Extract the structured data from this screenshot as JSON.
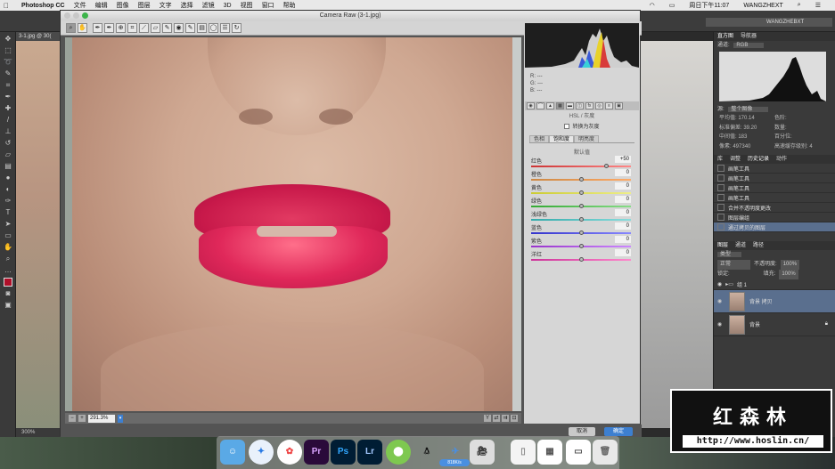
{
  "menubar": {
    "app": "Photoshop CC",
    "items": [
      "文件",
      "编辑",
      "图像",
      "图层",
      "文字",
      "选择",
      "滤镜",
      "3D",
      "视图",
      "窗口",
      "帮助"
    ],
    "clock": "周日下午11:07",
    "user": "WANGZHEXT"
  },
  "ps": {
    "doc_tab": "3-1.jpg @ 30(",
    "zoom_status": "300%",
    "workspace": "WANGZHEBXT"
  },
  "camera_raw": {
    "title": "Camera Raw (3-1.jpg)",
    "zoom": "291.3%",
    "rgb": {
      "r": "R:",
      "g": "G:",
      "b": "B:",
      "r_val": "---",
      "g_val": "---",
      "b_val": "---"
    },
    "panel_title": "HSL / 灰度",
    "convert_gray": "转换为灰度",
    "subtabs": [
      "色相",
      "饱和度",
      "明亮度"
    ],
    "default_link": "默认值",
    "sliders": [
      {
        "label": "红色",
        "value": "+50",
        "pos": 0.75
      },
      {
        "label": "橙色",
        "value": "0",
        "pos": 0.5
      },
      {
        "label": "黄色",
        "value": "0",
        "pos": 0.5
      },
      {
        "label": "绿色",
        "value": "0",
        "pos": 0.5
      },
      {
        "label": "浅绿色",
        "value": "0",
        "pos": 0.5
      },
      {
        "label": "蓝色",
        "value": "0",
        "pos": 0.5
      },
      {
        "label": "紫色",
        "value": "0",
        "pos": 0.5
      },
      {
        "label": "洋红",
        "value": "0",
        "pos": 0.5
      }
    ],
    "cancel": "取消",
    "ok": "确定"
  },
  "right_panel": {
    "tabs": [
      "直方图",
      "导航器"
    ],
    "channel_label": "通道:",
    "channel_value": "RGB",
    "source_label": "源:",
    "source_value": "整个图像",
    "stats": [
      {
        "k": "平均值:",
        "v": "170.14"
      },
      {
        "k": "色阶:",
        "v": ""
      },
      {
        "k": "标准偏差:",
        "v": "39.20"
      },
      {
        "k": "数量:",
        "v": ""
      },
      {
        "k": "中间值:",
        "v": "183"
      },
      {
        "k": "百分位:",
        "v": ""
      },
      {
        "k": "像素:",
        "v": "497340"
      },
      {
        "k": "高速缓存级别:",
        "v": "4"
      }
    ],
    "history_tabs": [
      "库",
      "调整",
      "历史记录",
      "动作"
    ],
    "history": [
      "画笔工具",
      "画笔工具",
      "画笔工具",
      "画笔工具",
      "合并不透明度更改",
      "图层编组",
      "通过拷贝的图层"
    ],
    "layer_tabs": [
      "图层",
      "通道",
      "路径"
    ],
    "blend": "正常",
    "opacity_label": "不透明度:",
    "opacity": "100%",
    "fill_label": "填充:",
    "fill": "100%",
    "lock_label": "锁定:",
    "kind": "类型",
    "layers": [
      {
        "name": "组 1",
        "group": true
      },
      {
        "name": "背景 拷贝",
        "group": false
      },
      {
        "name": "背景",
        "group": false
      }
    ]
  },
  "watermark": {
    "title": "红森林",
    "url": "http://www.hoslin.cn/"
  },
  "dock": {
    "items": [
      "finder",
      "safari",
      "photos",
      "Pr",
      "Ps",
      "Lr",
      "maps",
      "qq",
      "weibo",
      "video",
      "file",
      "calendar",
      "notes",
      "trash"
    ],
    "badge": "818K/s"
  }
}
